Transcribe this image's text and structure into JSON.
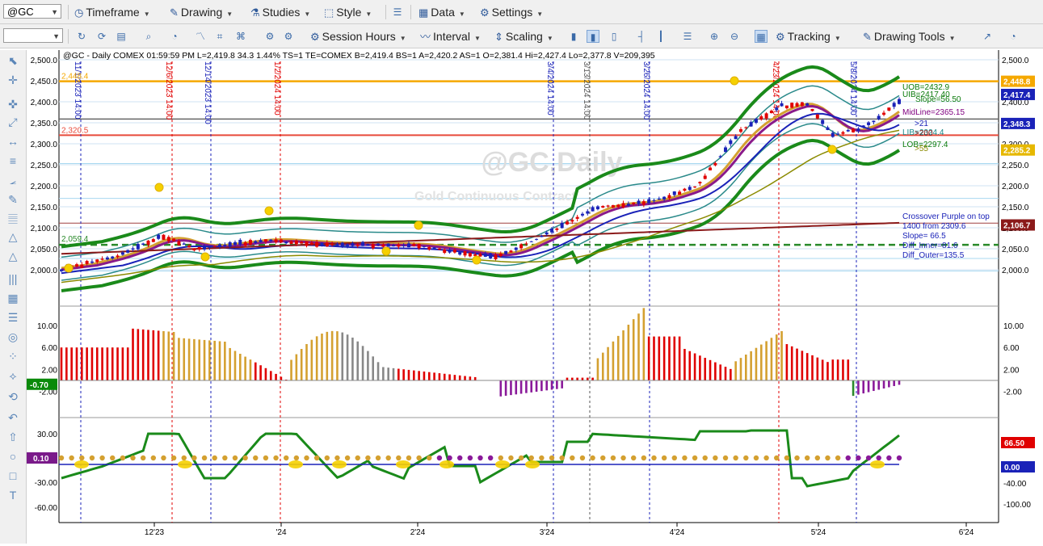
{
  "toolbar_top": {
    "symbol_value": "@GC",
    "timeframe": "Timeframe",
    "drawing": "Drawing",
    "studies": "Studies",
    "style": "Style",
    "data": "Data",
    "settings": "Settings"
  },
  "toolbar_second": {
    "session_hours": "Session Hours",
    "interval": "Interval",
    "scaling": "Scaling",
    "tracking": "Tracking",
    "drawing_tools": "Drawing Tools"
  },
  "chart": {
    "header": "@GC - Daily  COMEX  01:59:59 PM  L=2,419.8  34.3  1.44%  TS=1  TE=COMEX  B=2,419.4  BS=1  A=2,420.2  AS=1  O=2,381.4  Hi=2,427.4  Lo=2,377.8  V=209,395",
    "watermark": "@GC,Daily",
    "watermark_sub": "Gold Continuous Contract",
    "price_axis": [
      "2,500.0",
      "2,450.0",
      "2,400.0",
      "2,350.0",
      "2,300.0",
      "2,250.0",
      "2,200.0",
      "2,150.0",
      "2,100.0",
      "2,050.0",
      "2,000.0"
    ],
    "price_markers": [
      {
        "text": "2,448.8",
        "color": "#f5a800"
      },
      {
        "text": "2,417.4",
        "color": "#1a22b8"
      },
      {
        "text": "2,348.3",
        "color": "#1a22b8"
      },
      {
        "text": "2,285.2",
        "color": "#e6b800"
      },
      {
        "text": "2,106.7",
        "color": "#8b1a1a"
      }
    ],
    "level_labels": [
      "2,448.4",
      "2,320.5",
      "2,059.4"
    ],
    "band_labels": [
      {
        "text": "UOB=2432.9",
        "color": "#0a7a0a"
      },
      {
        "text": "UIB=2417.40",
        "color": "#0a7a0a"
      },
      {
        "text": "Slope=56.50",
        "color": "#0a7a0a"
      },
      {
        "text": "MidLine=2365.15",
        "color": "#800080"
      },
      {
        "text": ">21",
        "color": "#1a22b8"
      },
      {
        "text": "LIB=2324.4",
        "color": "#1a8a8a"
      },
      {
        "text": ">200",
        "color": "#8b1a1a"
      },
      {
        "text": "LOB=2297.4",
        "color": "#0a7a0a"
      },
      {
        "text": ">55",
        "color": "#8b8b00"
      }
    ],
    "info_lines": [
      "Crossover Purple on top",
      "1400 from 2309.6",
      "Slope= 66.5",
      "Diff_Inner=81.6",
      "Diff_Outer=135.5"
    ],
    "vlines": [
      {
        "label": "11/1/2023 14:00",
        "color": "#1a22b8"
      },
      {
        "label": "12/6/2023 14:00",
        "color": "#e00000"
      },
      {
        "label": "12/14/2023 14:00",
        "color": "#1a22b8"
      },
      {
        "label": "1/2/2024 14:00",
        "color": "#e00000"
      },
      {
        "label": "3/4/2024 14:00",
        "color": "#1a22b8"
      },
      {
        "label": "3/13/2024 14:00",
        "color": "#555555"
      },
      {
        "label": "3/26/2024 14:00",
        "color": "#1a22b8"
      },
      {
        "label": "4/23/2024 14:00",
        "color": "#e00000"
      },
      {
        "label": "5/8/2024 14:00",
        "color": "#1a22b8"
      }
    ],
    "osc1_axis": [
      "10.00",
      "6.00",
      "2.00",
      "-2.00"
    ],
    "osc1_marker": "-0.70",
    "osc2_axis_left": [
      "30.00",
      "-30.00",
      "-60.00"
    ],
    "osc2_marker_left": "0.10",
    "osc2_axis_right": [
      "-40.00",
      "-100.00"
    ],
    "osc2_markers_right": [
      {
        "text": "66.50",
        "color": "#e00000"
      },
      {
        "text": "0.00",
        "color": "#1a22b8"
      }
    ],
    "date_axis": [
      "12'23",
      "'24",
      "2'24",
      "3'24",
      "4'24",
      "5'24",
      "6'24"
    ]
  },
  "left_tools": [
    "pointer-icon",
    "crosshair-icon",
    "wrench-icon",
    "fit-icon",
    "line-icon",
    "parallel-icon",
    "angle-icon",
    "pencil-icon",
    "fib-icon",
    "triangle-icon",
    "triangle-outline-icon",
    "bars-icon",
    "grid-icon",
    "levels-icon",
    "spiral-icon",
    "dots-icon",
    "gann-icon",
    "arc-icon",
    "undo-icon",
    "up-arrow-icon",
    "circle-icon",
    "square-icon",
    "text-icon"
  ]
}
